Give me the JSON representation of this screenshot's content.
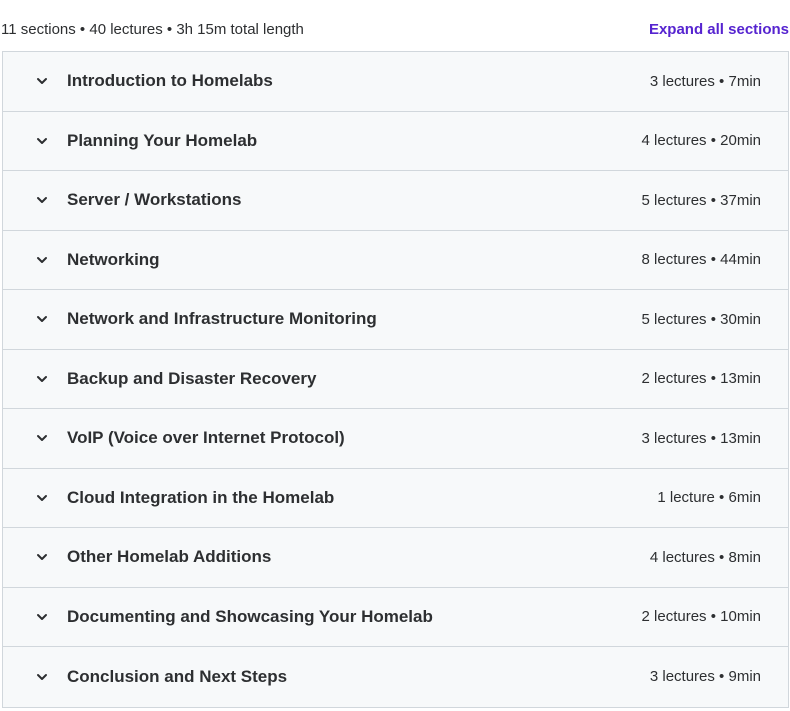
{
  "summary": {
    "text": "11 sections • 40 lectures • 3h 15m total length",
    "expand_label": "Expand all sections"
  },
  "colors": {
    "accent": "#5624d0",
    "row_background": "#f7f9fa",
    "border": "#d1d7dc",
    "text": "#2d2f31"
  },
  "sections": [
    {
      "title": "Introduction to Homelabs",
      "meta": "3 lectures • 7min",
      "icon": "chevron-down-icon"
    },
    {
      "title": "Planning Your Homelab",
      "meta": "4 lectures • 20min",
      "icon": "chevron-down-icon"
    },
    {
      "title": "Server / Workstations",
      "meta": "5 lectures • 37min",
      "icon": "chevron-down-icon"
    },
    {
      "title": "Networking",
      "meta": "8 lectures • 44min",
      "icon": "chevron-down-icon"
    },
    {
      "title": "Network and Infrastructure Monitoring",
      "meta": "5 lectures • 30min",
      "icon": "chevron-down-icon"
    },
    {
      "title": "Backup and Disaster Recovery",
      "meta": "2 lectures • 13min",
      "icon": "chevron-down-icon"
    },
    {
      "title": "VoIP (Voice over Internet Protocol)",
      "meta": "3 lectures • 13min",
      "icon": "chevron-down-icon"
    },
    {
      "title": "Cloud Integration in the Homelab",
      "meta": "1 lecture • 6min",
      "icon": "chevron-down-icon"
    },
    {
      "title": "Other Homelab Additions",
      "meta": "4 lectures • 8min",
      "icon": "chevron-down-icon"
    },
    {
      "title": "Documenting and Showcasing Your Homelab",
      "meta": "2 lectures • 10min",
      "icon": "chevron-down-icon"
    },
    {
      "title": "Conclusion and Next Steps",
      "meta": "3 lectures • 9min",
      "icon": "chevron-down-icon"
    }
  ]
}
